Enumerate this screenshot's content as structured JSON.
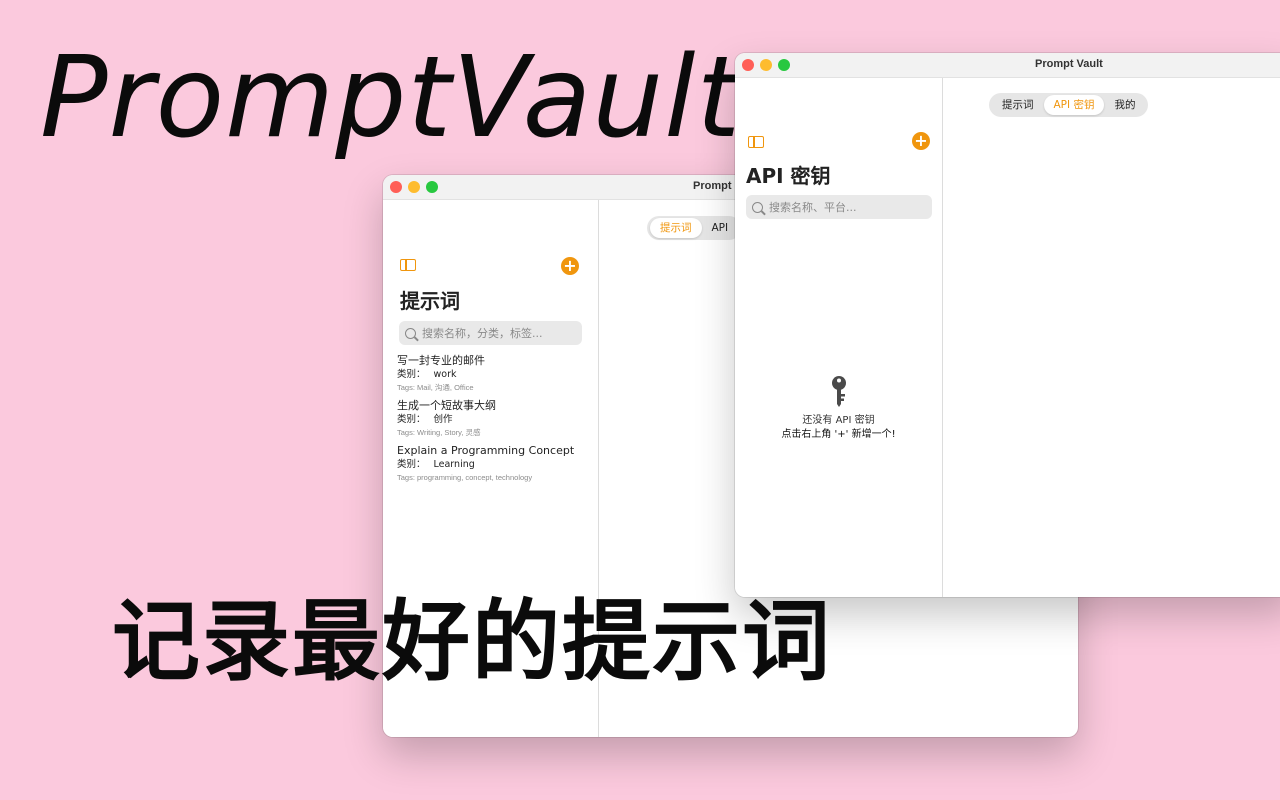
{
  "hero": {
    "brand": "PromptVault",
    "slogan": "记录最好的提示词"
  },
  "window_back": {
    "title": "Prompt",
    "tabs": [
      {
        "label": "提示词",
        "active": true
      },
      {
        "label": "API",
        "active": false
      }
    ],
    "sidebar": {
      "add_label": "+",
      "title": "提示词",
      "search_placeholder": "搜索名称，分类，标签...",
      "category_label": "类别：",
      "items": [
        {
          "title": "写一封专业的邮件",
          "category": "work",
          "tags": "Tags: Mail, 沟通, Office"
        },
        {
          "title": "生成一个短故事大纲",
          "category": "创作",
          "tags": "Tags: Writing, Story, 灵感"
        },
        {
          "title": "Explain a Programming Concept",
          "category": "Learning",
          "tags": "Tags: programming, concept, technology"
        }
      ]
    }
  },
  "window_front": {
    "title": "Prompt Vault",
    "tabs": [
      {
        "label": "提示词",
        "active": false
      },
      {
        "label": "API 密钥",
        "active": true
      },
      {
        "label": "我的",
        "active": false
      }
    ],
    "sidebar": {
      "add_label": "+",
      "title": "API 密钥",
      "search_placeholder": "搜索名称、平台...",
      "empty_line1": "还没有 API 密钥",
      "empty_line2": "点击右上角 '+' 新增一个!"
    }
  },
  "colors": {
    "background": "#fbc9dd",
    "accent": "#f0960e"
  },
  "icons": [
    "sidebar-toggle-icon",
    "plus-icon",
    "search-icon",
    "key-icon"
  ]
}
